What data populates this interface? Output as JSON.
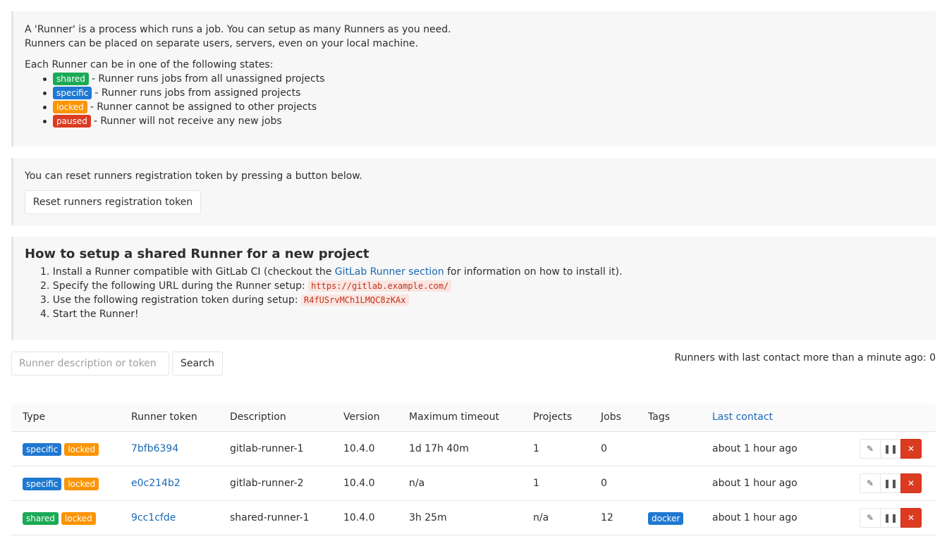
{
  "intro": {
    "line1": "A 'Runner' is a process which runs a job. You can setup as many Runners as you need.",
    "line2": "Runners can be placed on separate users, servers, even on your local machine.",
    "states_title": "Each Runner can be in one of the following states:",
    "states": [
      {
        "badge": "shared",
        "text": "- Runner runs jobs from all unassigned projects",
        "color": "#1aaa55"
      },
      {
        "badge": "specific",
        "text": "- Runner runs jobs from assigned projects",
        "color": "#1f78d1"
      },
      {
        "badge": "locked",
        "text": "- Runner cannot be assigned to other projects",
        "color": "#fc9403"
      },
      {
        "badge": "paused",
        "text": "- Runner will not receive any new jobs",
        "color": "#db3b21"
      }
    ]
  },
  "reset": {
    "text": "You can reset runners registration token by pressing a button below.",
    "button_label": "Reset runners registration token"
  },
  "setup": {
    "title": "How to setup a shared Runner for a new project",
    "step1_prefix": "1. Install a Runner compatible with GitLab CI (checkout the ",
    "step1_link": "GitLab Runner section",
    "step1_suffix": " for information on how to install it).",
    "step2_prefix": "2. Specify the following URL during the Runner setup: ",
    "step2_code": "https://gitlab.example.com/",
    "step3_prefix": "3. Use the following registration token during setup: ",
    "step3_code": "R4fUSrvMCh1LMQC8zKAx",
    "step4": "4. Start the Runner!"
  },
  "search": {
    "placeholder": "Runner description or token",
    "button_label": "Search",
    "last_contact_note": "Runners with last contact more than a minute ago: 0"
  },
  "table": {
    "headers": {
      "type": "Type",
      "token": "Runner token",
      "description": "Description",
      "version": "Version",
      "timeout": "Maximum timeout",
      "projects": "Projects",
      "jobs": "Jobs",
      "tags": "Tags",
      "last_contact": "Last contact"
    },
    "rows": [
      {
        "type1": "specific",
        "type2": "locked",
        "token": "7bfb6394",
        "description": "gitlab-runner-1",
        "version": "10.4.0",
        "timeout": "1d 17h 40m",
        "projects": "1",
        "jobs": "0",
        "tag": "",
        "last_contact": "about 1 hour ago"
      },
      {
        "type1": "specific",
        "type2": "locked",
        "token": "e0c214b2",
        "description": "gitlab-runner-2",
        "version": "10.4.0",
        "timeout": "n/a",
        "projects": "1",
        "jobs": "0",
        "tag": "",
        "last_contact": "about 1 hour ago"
      },
      {
        "type1": "shared",
        "type2": "locked",
        "token": "9cc1cfde",
        "description": "shared-runner-1",
        "version": "10.4.0",
        "timeout": "3h 25m",
        "projects": "n/a",
        "jobs": "12",
        "tag": "docker",
        "last_contact": "about 1 hour ago"
      }
    ],
    "action_icons": [
      "pencil-icon",
      "pause-icon",
      "close-icon"
    ]
  }
}
